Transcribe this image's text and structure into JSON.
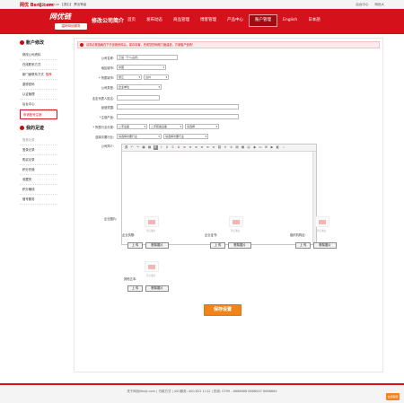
{
  "topbar": {
    "logo": "网优 Benj.com",
    "welcome": "您好, enujl.cn 【退出】 票出等级",
    "links": [
      "后台中心",
      "网优大"
    ]
  },
  "header": {
    "brand_main": "网优链",
    "brand_sub": "温岭网优服务",
    "page_name": "修改公司简介",
    "nav": [
      "首页",
      "发布动态",
      "商品管理",
      "博客管理",
      "产品中心",
      "账户管理",
      "English",
      "日本語"
    ],
    "active_nav": "账户管理"
  },
  "sidebar": {
    "section1_title": "账户修改",
    "items": [
      {
        "label": "修改公司资料"
      },
      {
        "label": "在线联系方式"
      },
      {
        "label": "新门面联系方式",
        "hot": "推荐"
      },
      {
        "label": "重修密码"
      },
      {
        "label": "认证管理"
      },
      {
        "label": "后台中心"
      },
      {
        "label": "申请账号注销"
      }
    ],
    "section2_title": "我的足迹",
    "items2": [
      {
        "label": "登录记录"
      },
      {
        "label": "登录记录"
      },
      {
        "label": "购买记录"
      },
      {
        "label": "积分充值"
      },
      {
        "label": "收藏夹"
      },
      {
        "label": "积分赚钱"
      },
      {
        "label": "借号服务"
      }
    ]
  },
  "notice": {
    "text": "请务必按指南在下方设置资料后，保存设置，完成您的网络门面建设，方便客户查看！"
  },
  "form": {
    "company_name": {
      "label": "公司名称:",
      "value": "王福「什么品质」"
    },
    "region": {
      "label": "地区城市:",
      "value": "中国"
    },
    "contact_area": {
      "label": "所属城市:",
      "province": "浙江",
      "city": "台州"
    },
    "company_type": {
      "label": "公司类型:",
      "value": "企业单位"
    },
    "legal_person": {
      "label": "法定代表人姓名:",
      "value": ""
    },
    "business_scope": {
      "label": "经营范围:",
      "value": ""
    },
    "main_products": {
      "label": "*主营产品:",
      "value": ""
    },
    "industry": {
      "label": "所属行业分类:",
      "options": [
        "二手设备",
        "二手装备设备",
        "请选择"
      ]
    },
    "sub_industry": {
      "label": "选择次要行业:",
      "options": [
        "请选择次要行业",
        "请选择次要行业"
      ]
    },
    "intro": {
      "label": "公司简介:"
    }
  },
  "editor": {
    "toolbar": [
      "源",
      "↶",
      "↷",
      "▣",
      "▦",
      "B",
      "I",
      "U",
      "S",
      "A",
      "≡",
      "≡",
      "≡",
      "≡",
      "≡",
      "≡",
      "⛓",
      "✕",
      "⚓",
      "▤",
      "▦",
      "☺",
      "◉",
      "▭",
      "⊞",
      "▶",
      "◧",
      "⌕"
    ]
  },
  "uploads": {
    "company_photo_label": "企业图片:",
    "upload_btn": "上 传",
    "delete_btn": "删除图片",
    "no_image": "暂无图片",
    "license_label": "企业执照:",
    "certificate_label": "企业证书:",
    "qualification_label": "组织机构证:",
    "other_label": "其他正本:"
  },
  "save_button": "保存设置",
  "footer": {
    "text": "关于网优Benjt.com  |  付款方式  |  400服务: 400-622 1112  |  热线: 0799 - 6666666 6666647 6666664"
  },
  "fab": "在线客服"
}
